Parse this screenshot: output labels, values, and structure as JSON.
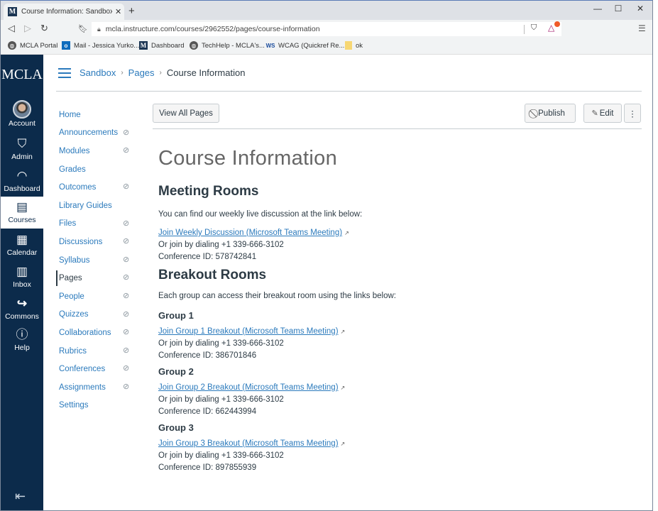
{
  "browser": {
    "tab_title": "Course Information: Sandbox Cou",
    "tab_favicon": "M",
    "url": "mcla.instructure.com/courses/2962552/pages/course-information",
    "bookmarks": [
      {
        "label": "MCLA Portal",
        "icon": "globe-icon"
      },
      {
        "label": "Mail - Jessica Yurko...",
        "icon": "outlook-icon"
      },
      {
        "label": "Dashboard",
        "icon": "mcla-icon"
      },
      {
        "label": "TechHelp - MCLA's...",
        "icon": "globe-icon"
      },
      {
        "label": "WCAG (Quickref Re...",
        "icon": "ws-icon"
      },
      {
        "label": "ok",
        "icon": "folder-icon"
      }
    ],
    "extension_badge_color": "#f05a28"
  },
  "global_nav": {
    "logo": "MCLA",
    "items": [
      {
        "label": "Account",
        "icon": "avatar"
      },
      {
        "label": "Admin",
        "icon": "shield-wrench-icon"
      },
      {
        "label": "Dashboard",
        "icon": "speedometer-icon"
      },
      {
        "label": "Courses",
        "icon": "book-icon",
        "active": true
      },
      {
        "label": "Calendar",
        "icon": "calendar-icon"
      },
      {
        "label": "Inbox",
        "icon": "inbox-icon"
      },
      {
        "label": "Commons",
        "icon": "commons-arrow-icon"
      },
      {
        "label": "Help",
        "icon": "help-circle-icon"
      }
    ],
    "bg_color": "#0c2b4b"
  },
  "breadcrumb": {
    "items": [
      "Sandbox",
      "Pages"
    ],
    "current": "Course Information"
  },
  "course_nav": {
    "items": [
      {
        "label": "Home",
        "hidden": false
      },
      {
        "label": "Announcements",
        "hidden": true
      },
      {
        "label": "Modules",
        "hidden": true
      },
      {
        "label": "Grades",
        "hidden": false
      },
      {
        "label": "Outcomes",
        "hidden": true
      },
      {
        "label": "Library Guides",
        "hidden": false
      },
      {
        "label": "Files",
        "hidden": true
      },
      {
        "label": "Discussions",
        "hidden": true
      },
      {
        "label": "Syllabus",
        "hidden": true
      },
      {
        "label": "Pages",
        "hidden": true,
        "active": true
      },
      {
        "label": "People",
        "hidden": true
      },
      {
        "label": "Quizzes",
        "hidden": true
      },
      {
        "label": "Collaborations",
        "hidden": true
      },
      {
        "label": "Rubrics",
        "hidden": true
      },
      {
        "label": "Conferences",
        "hidden": true
      },
      {
        "label": "Assignments",
        "hidden": true
      },
      {
        "label": "Settings",
        "hidden": false
      }
    ],
    "link_color": "#2b7abc"
  },
  "toolbar": {
    "view_all_pages": "View All Pages",
    "publish": "Publish",
    "edit": "Edit",
    "more": "⋮"
  },
  "page": {
    "title": "Course Information",
    "meeting": {
      "heading": "Meeting Rooms",
      "intro": "You can find our weekly live discussion at the link below:",
      "link": "Join Weekly Discussion (Microsoft Teams Meeting)",
      "dial": "Or join by dialing +1 339-666-3102",
      "conference_id": "Conference ID: 578742841"
    },
    "breakout": {
      "heading": "Breakout Rooms",
      "intro": "Each group can access their breakout room using the links below:",
      "groups": [
        {
          "name": "Group 1",
          "link": "Join Group 1 Breakout (Microsoft Teams Meeting)",
          "dial": "Or join by dialing +1 339-666-3102",
          "conference_id": "Conference ID: 386701846"
        },
        {
          "name": "Group 2",
          "link": "Join Group 2 Breakout (Microsoft Teams Meeting)",
          "dial": "Or join by dialing +1 339-666-3102",
          "conference_id": "Conference ID: 662443994"
        },
        {
          "name": "Group 3",
          "link": "Join Group 3 Breakout (Microsoft Teams Meeting)",
          "dial": "Or join by dialing +1 339-666-3102",
          "conference_id": "Conference ID: 897855939"
        }
      ]
    }
  }
}
